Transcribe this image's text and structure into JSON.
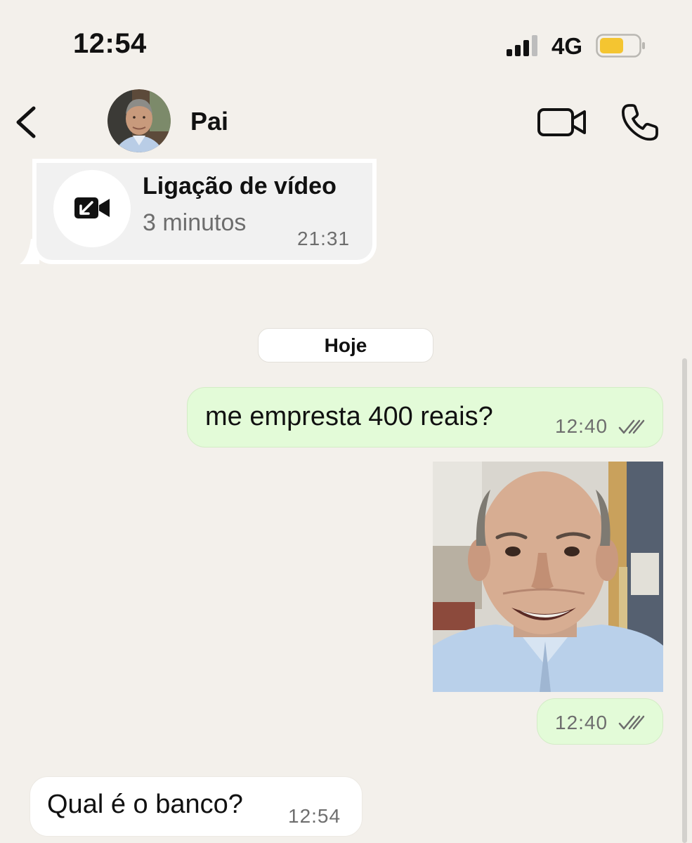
{
  "status_bar": {
    "time": "12:54",
    "network": "4G",
    "battery_color": "#f4c531"
  },
  "header": {
    "contact_name": "Pai",
    "back_icon": "chevron-left-icon",
    "video_icon": "video-camera-icon",
    "phone_icon": "phone-icon"
  },
  "messages": {
    "call_log": {
      "title": "Ligação de vídeo",
      "duration": "3 minutos",
      "time": "21:31",
      "icon": "incoming-video-call-icon"
    },
    "date_separator": "Hoje",
    "outgoing_text": {
      "text": "me empresta 400 reais?",
      "time": "12:40",
      "status": "read"
    },
    "outgoing_sticker": {
      "time": "12:40",
      "status": "read"
    },
    "incoming_text": {
      "text": "Qual é o banco?",
      "time": "12:54"
    }
  },
  "colors": {
    "background": "#f3f0eb",
    "outgoing_bubble": "#e3fbd8",
    "incoming_bubble": "#ffffff"
  }
}
